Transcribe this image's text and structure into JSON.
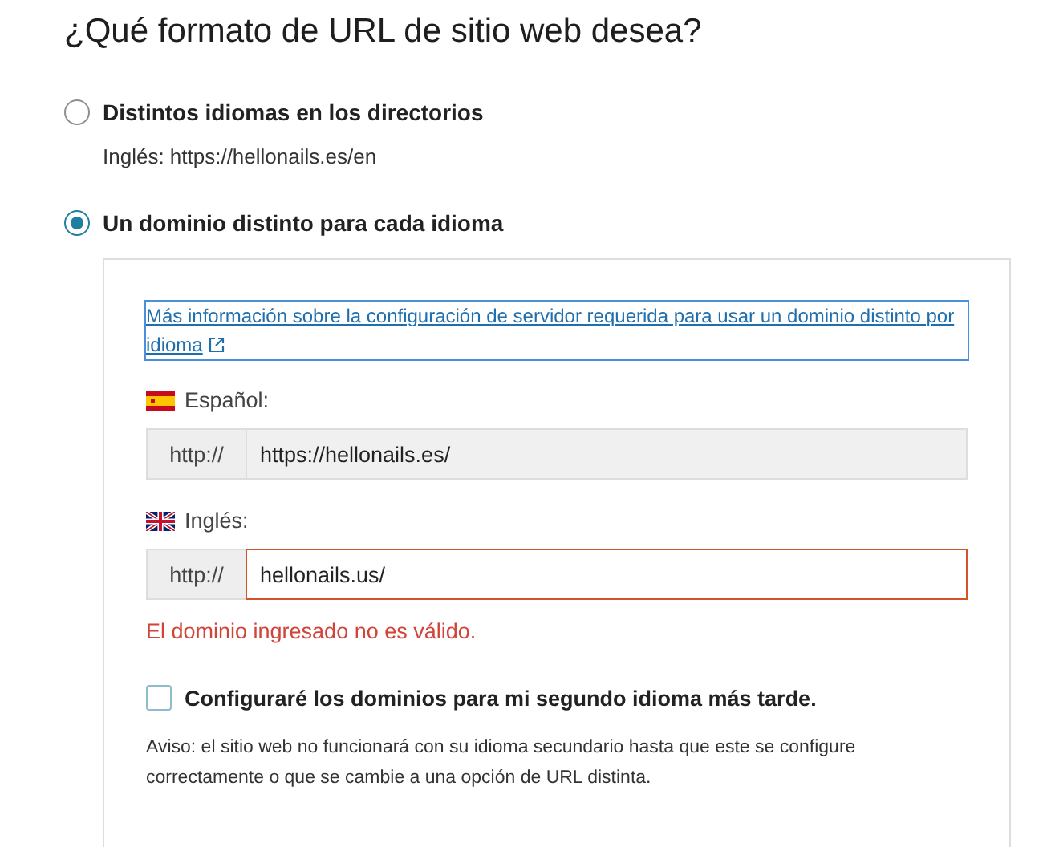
{
  "title": "¿Qué formato de URL de sitio web desea?",
  "options": [
    {
      "label": "Distintos idiomas en los directorios",
      "selected": false,
      "hint": "Inglés: https://hellonails.es/en"
    },
    {
      "label": "Un dominio distinto para cada idioma",
      "selected": true
    }
  ],
  "panel": {
    "info_link": "Más información sobre la configuración de servidor requerida para usar un dominio distinto por idioma",
    "languages": [
      {
        "label": "Español:",
        "prefix": "http://",
        "value": "https://hellonails.es/",
        "readonly": true,
        "invalid": false
      },
      {
        "label": "Inglés:",
        "prefix": "http://",
        "value": "hellonails.us/",
        "readonly": false,
        "invalid": true,
        "error": "El dominio ingresado no es válido."
      }
    ],
    "later_checkbox": {
      "label": "Configuraré los dominios para mi segundo idioma más tarde.",
      "checked": false
    },
    "notice": "Aviso: el sitio web no funcionará con su idioma secundario hasta que este se configure correctamente o que se cambie a una opción de URL distinta."
  }
}
